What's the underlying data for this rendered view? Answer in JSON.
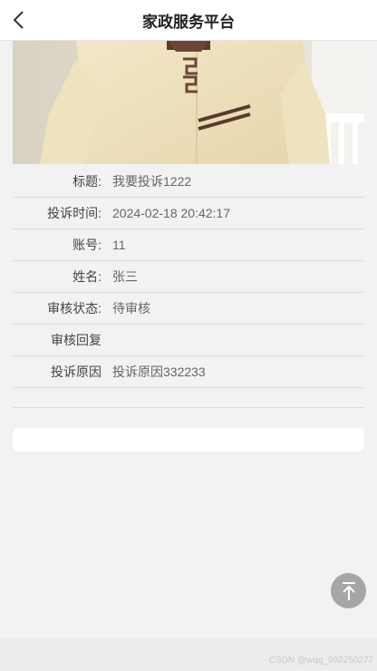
{
  "header": {
    "title": "家政服务平台",
    "back_icon": "chevron-left-icon"
  },
  "details": {
    "title_label": "标题:",
    "title_value": "我要投诉1222",
    "time_label": "投诉时间:",
    "time_value": "2024-02-18 20:42:17",
    "account_label": "账号:",
    "account_value": "11",
    "name_label": "姓名:",
    "name_value": "张三",
    "status_label": "审核状态:",
    "status_value": "待审核",
    "reply_label": "审核回复",
    "reply_value": "",
    "reason_label": "投诉原因",
    "reason_value": "投诉原因332233"
  },
  "back_to_top_icon": "arrow-up-icon",
  "watermark": "CSDN @wqq_992250277"
}
